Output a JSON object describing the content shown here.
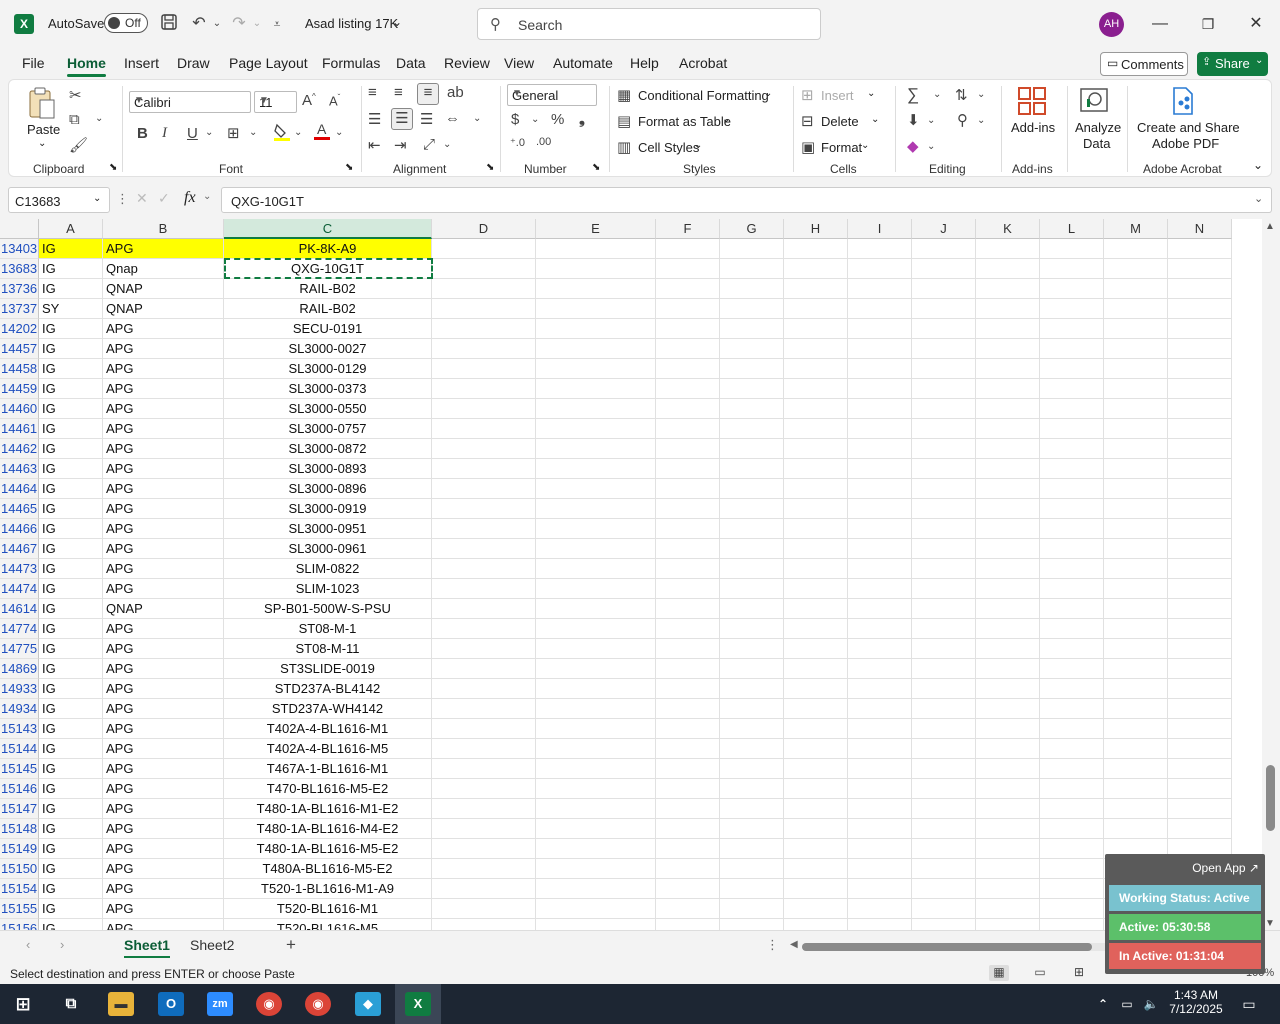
{
  "titlebar": {
    "autosave_label": "AutoSave",
    "autosave_state": "Off",
    "file_name": "Asad listing 17K",
    "search_placeholder": "Search",
    "user_initials": "AH",
    "app_icon": "X"
  },
  "menu": {
    "tabs": [
      "File",
      "Home",
      "Insert",
      "Draw",
      "Page Layout",
      "Formulas",
      "Data",
      "Review",
      "View",
      "Automate",
      "Help",
      "Acrobat"
    ],
    "active_tab": "Home",
    "comments_label": "Comments",
    "share_label": "Share"
  },
  "ribbon": {
    "clipboard": {
      "paste_label": "Paste",
      "group_label": "Clipboard"
    },
    "font": {
      "font_name": "Calibri",
      "font_size": "11",
      "group_label": "Font",
      "bold": "B",
      "italic": "I",
      "underline": "U"
    },
    "alignment": {
      "group_label": "Alignment"
    },
    "number": {
      "format": "General",
      "group_label": "Number"
    },
    "styles": {
      "conditional_formatting": "Conditional Formatting",
      "format_as_table": "Format as Table",
      "cell_styles": "Cell Styles",
      "group_label": "Styles"
    },
    "cells": {
      "insert": "Insert",
      "delete": "Delete",
      "format": "Format",
      "group_label": "Cells"
    },
    "editing": {
      "group_label": "Editing"
    },
    "addins": {
      "addins_label": "Add-ins",
      "group_label": "Add-ins"
    },
    "analyze": {
      "label_line1": "Analyze",
      "label_line2": "Data"
    },
    "acrobat": {
      "label_line1": "Create and Share",
      "label_line2": "Adobe PDF",
      "group_label": "Adobe Acrobat"
    }
  },
  "formula_bar": {
    "name_box": "C13683",
    "fx": "fx",
    "content": "QXG-10G1T"
  },
  "columns": [
    "A",
    "B",
    "C",
    "D",
    "E",
    "F",
    "G",
    "H",
    "I",
    "J",
    "K",
    "L",
    "M",
    "N"
  ],
  "rows": [
    {
      "num": "13403",
      "a": "IG",
      "b": "APG",
      "c": "PK-8K-A9",
      "highlight": true
    },
    {
      "num": "13683",
      "a": "IG",
      "b": "Qnap",
      "c": "QXG-10G1T"
    },
    {
      "num": "13736",
      "a": "IG",
      "b": "QNAP",
      "c": "RAIL-B02"
    },
    {
      "num": "13737",
      "a": "SY",
      "b": "QNAP",
      "c": "RAIL-B02"
    },
    {
      "num": "14202",
      "a": "IG",
      "b": "APG",
      "c": "SECU-0191"
    },
    {
      "num": "14457",
      "a": "IG",
      "b": "APG",
      "c": "SL3000-0027"
    },
    {
      "num": "14458",
      "a": "IG",
      "b": "APG",
      "c": "SL3000-0129"
    },
    {
      "num": "14459",
      "a": "IG",
      "b": "APG",
      "c": "SL3000-0373"
    },
    {
      "num": "14460",
      "a": "IG",
      "b": "APG",
      "c": "SL3000-0550"
    },
    {
      "num": "14461",
      "a": "IG",
      "b": "APG",
      "c": "SL3000-0757"
    },
    {
      "num": "14462",
      "a": "IG",
      "b": "APG",
      "c": "SL3000-0872"
    },
    {
      "num": "14463",
      "a": "IG",
      "b": "APG",
      "c": "SL3000-0893"
    },
    {
      "num": "14464",
      "a": "IG",
      "b": "APG",
      "c": "SL3000-0896"
    },
    {
      "num": "14465",
      "a": "IG",
      "b": "APG",
      "c": "SL3000-0919"
    },
    {
      "num": "14466",
      "a": "IG",
      "b": "APG",
      "c": "SL3000-0951"
    },
    {
      "num": "14467",
      "a": "IG",
      "b": "APG",
      "c": "SL3000-0961"
    },
    {
      "num": "14473",
      "a": "IG",
      "b": "APG",
      "c": "SLIM-0822"
    },
    {
      "num": "14474",
      "a": "IG",
      "b": "APG",
      "c": "SLIM-1023"
    },
    {
      "num": "14614",
      "a": "IG",
      "b": "QNAP",
      "c": "SP-B01-500W-S-PSU"
    },
    {
      "num": "14774",
      "a": "IG",
      "b": "APG",
      "c": "ST08-M-1"
    },
    {
      "num": "14775",
      "a": "IG",
      "b": "APG",
      "c": "ST08-M-11"
    },
    {
      "num": "14869",
      "a": "IG",
      "b": "APG",
      "c": "ST3SLIDE-0019"
    },
    {
      "num": "14933",
      "a": "IG",
      "b": "APG",
      "c": "STD237A-BL4142"
    },
    {
      "num": "14934",
      "a": "IG",
      "b": "APG",
      "c": "STD237A-WH4142"
    },
    {
      "num": "15143",
      "a": "IG",
      "b": "APG",
      "c": "T402A-4-BL1616-M1"
    },
    {
      "num": "15144",
      "a": "IG",
      "b": "APG",
      "c": "T402A-4-BL1616-M5"
    },
    {
      "num": "15145",
      "a": "IG",
      "b": "APG",
      "c": "T467A-1-BL1616-M1"
    },
    {
      "num": "15146",
      "a": "IG",
      "b": "APG",
      "c": "T470-BL1616-M5-E2"
    },
    {
      "num": "15147",
      "a": "IG",
      "b": "APG",
      "c": "T480-1A-BL1616-M1-E2"
    },
    {
      "num": "15148",
      "a": "IG",
      "b": "APG",
      "c": "T480-1A-BL1616-M4-E2"
    },
    {
      "num": "15149",
      "a": "IG",
      "b": "APG",
      "c": "T480-1A-BL1616-M5-E2"
    },
    {
      "num": "15150",
      "a": "IG",
      "b": "APG",
      "c": "T480A-BL1616-M5-E2"
    },
    {
      "num": "15154",
      "a": "IG",
      "b": "APG",
      "c": "T520-1-BL1616-M1-A9"
    },
    {
      "num": "15155",
      "a": "IG",
      "b": "APG",
      "c": "T520-BL1616-M1"
    },
    {
      "num": "15156",
      "a": "IG",
      "b": "APG",
      "c": "T520-BL1616-M5"
    }
  ],
  "sheets": [
    "Sheet1",
    "Sheet2"
  ],
  "active_sheet": "Sheet1",
  "status": {
    "message": "Select destination and press ENTER or choose Paste",
    "zoom": "100%"
  },
  "widget": {
    "open_app": "Open App ↗",
    "working_status": "Working Status: Active",
    "active_time": "Active: 05:30:58",
    "inactive_time": "In Active: 01:31:04",
    "colors": {
      "status": "#79c2cf",
      "active": "#5cc06a",
      "inactive": "#e0625c"
    }
  },
  "taskbar": {
    "time": "1:43 AM",
    "date": "7/12/2025"
  },
  "colors": {
    "accent": "#107c41",
    "highlight": "#ffff00"
  }
}
